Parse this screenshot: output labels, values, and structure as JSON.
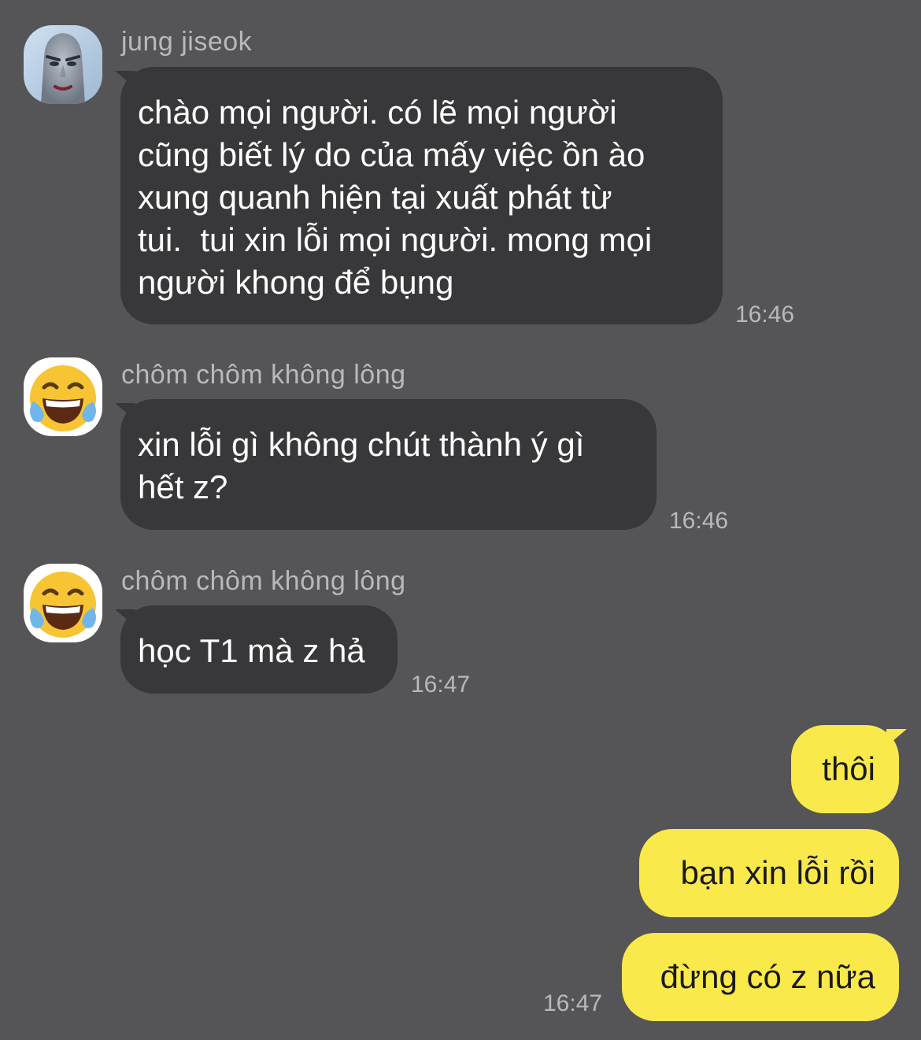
{
  "messages": [
    {
      "sender": "jung jiseok",
      "avatar_icon": "grey-face-photo-avatar",
      "text": "chào mọi người. có lẽ mọi người\ncũng biết lý do của mấy việc ồn ào\nxung quanh hiện tại xuất phát từ\ntui.  tui xin lỗi mọi người. mong mọi\nngười khong để bụng",
      "time": "16:46"
    },
    {
      "sender": "chôm chôm không lông",
      "avatar_icon": "tears-of-joy-emoji-icon",
      "text": "xin lỗi gì không chút thành ý gì\nhết z?",
      "time": "16:46"
    },
    {
      "sender": "chôm chôm không lông",
      "avatar_icon": "tears-of-joy-emoji-icon",
      "text": "học T1 mà z hả",
      "time": "16:47"
    }
  ],
  "outgoing": {
    "messages": [
      "thôi",
      "bạn xin lỗi rồi",
      "đừng có z nữa"
    ],
    "time": "16:47"
  },
  "colors": {
    "background": "#555456",
    "incoming_bubble": "#383739",
    "outgoing_bubble": "#fae94b",
    "meta_text": "#b9b8bb"
  }
}
